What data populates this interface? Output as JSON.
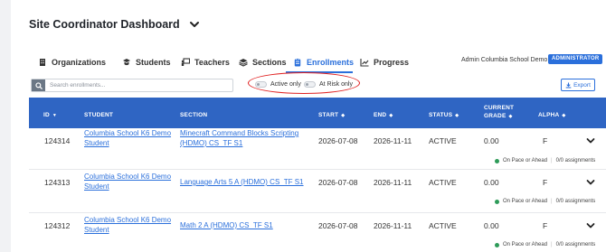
{
  "header": {
    "title": "Site Coordinator Dashboard"
  },
  "tabs": [
    {
      "label": "Organizations",
      "icon": "building-icon"
    },
    {
      "label": "Students",
      "icon": "students-icon"
    },
    {
      "label": "Teachers",
      "icon": "chalkboard-icon"
    },
    {
      "label": "Sections",
      "icon": "layers-icon"
    },
    {
      "label": "Enrollments",
      "icon": "clipboard-icon",
      "active": true
    },
    {
      "label": "Progress",
      "icon": "chart-icon"
    }
  ],
  "user": {
    "name": "Admin Columbia School Demo",
    "role": "ADMINISTRATOR"
  },
  "filters": {
    "search_placeholder": "Search enrollments...",
    "active_only": "Active only",
    "at_risk_only": "At Risk only",
    "export": "Export"
  },
  "table": {
    "columns": {
      "id": "ID",
      "student": "STUDENT",
      "section": "SECTION",
      "start": "START",
      "end": "END",
      "status": "STATUS",
      "grade_line1": "CURRENT",
      "grade_line2": "GRADE",
      "alpha": "ALPHA"
    },
    "rows": [
      {
        "id": "124314",
        "student_line1": "Columbia School K6 Demo",
        "student_line2": "Student",
        "section_line1": "Minecraft Command Blocks Scripting",
        "section_line2": "(HDMO) CS_TF S1",
        "start": "2026-07-08",
        "end": "2026-11-11",
        "status": "ACTIVE",
        "grade": "0.00",
        "alpha": "F",
        "pace": "On Pace or Ahead",
        "assignments": "0/0 assignments"
      },
      {
        "id": "124313",
        "student_line1": "Columbia School K6 Demo",
        "student_line2": "Student",
        "section_line1": "Language Arts 5 A (HDMO) CS_TF S1",
        "section_line2": "",
        "start": "2026-07-08",
        "end": "2026-11-11",
        "status": "ACTIVE",
        "grade": "0.00",
        "alpha": "F",
        "pace": "On Pace or Ahead",
        "assignments": "0/0 assignments"
      },
      {
        "id": "124312",
        "student_line1": "Columbia School K6 Demo",
        "student_line2": "Student",
        "section_line1": "Math 2 A (HDMO) CS_TF S1",
        "section_line2": "",
        "start": "2026-07-08",
        "end": "2026-11-11",
        "status": "ACTIVE",
        "grade": "0.00",
        "alpha": "F",
        "pace": "On Pace or Ahead",
        "assignments": "0/0 assignments"
      }
    ]
  },
  "colors": {
    "accent": "#2a6fdb",
    "header_bg": "#2f65c3",
    "pace_dot": "#2e9b59",
    "annotation": "#e02020"
  }
}
